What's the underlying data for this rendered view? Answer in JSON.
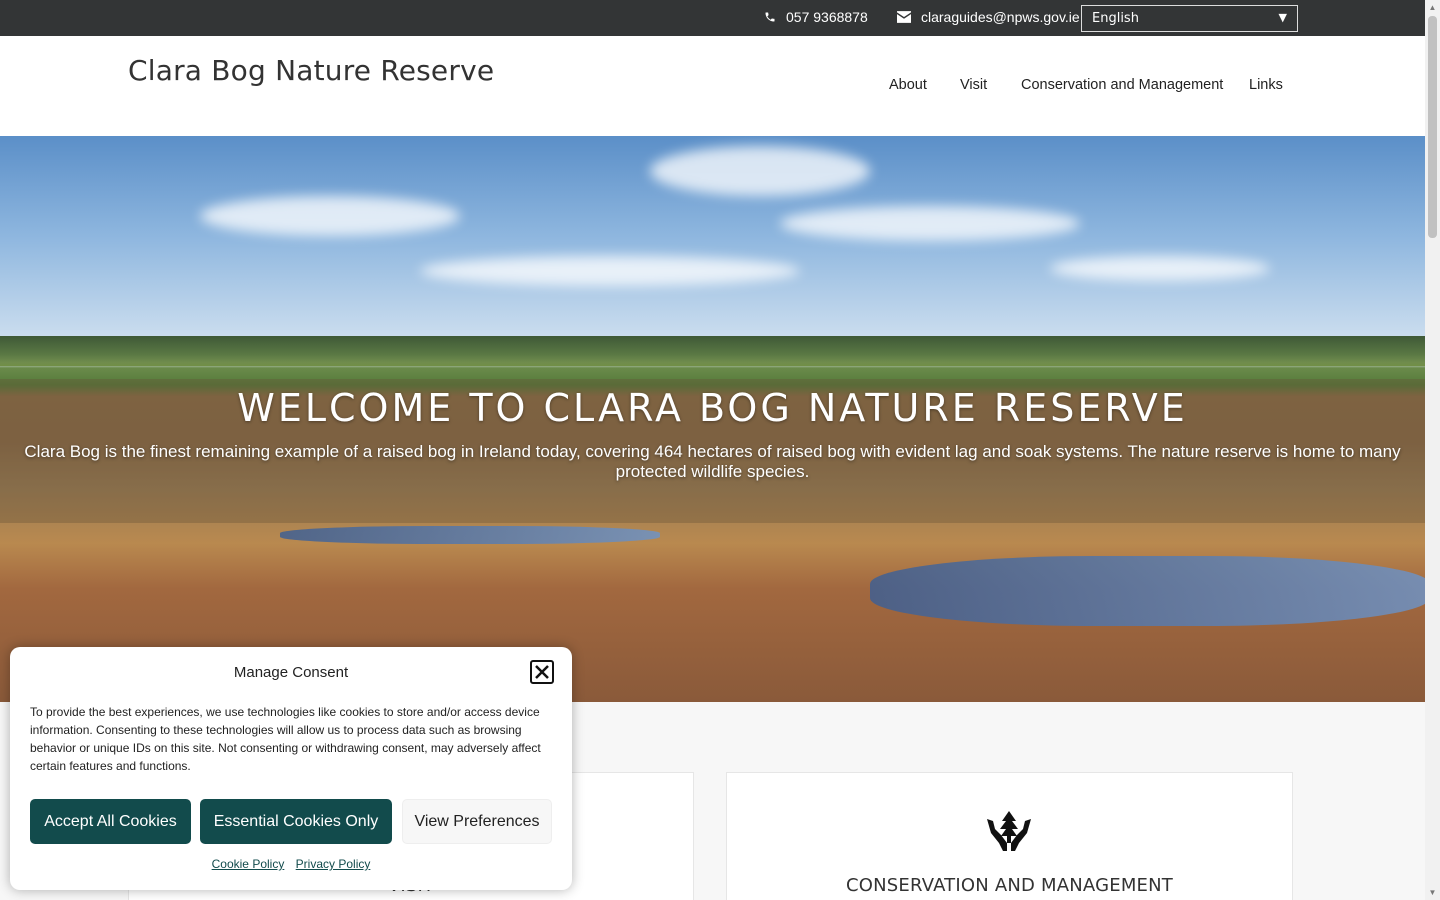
{
  "topbar": {
    "phone": "057 9368878",
    "email": "claraguides@npws.gov.ie",
    "language": "English",
    "icons": [
      "phone-icon",
      "envelope-icon"
    ]
  },
  "header": {
    "title": "Clara Bog Nature Reserve",
    "nav": [
      "About",
      "Visit",
      "Conservation and Management",
      "Links"
    ]
  },
  "hero": {
    "title": "WELCOME TO CLARA BOG NATURE RESERVE",
    "subtitle": "Clara Bog is the finest remaining example of a raised bog in Ireland today, covering 464 hectares of raised bog with evident lag and soak systems. The nature reserve is home to many protected wildlife species."
  },
  "cards": [
    {
      "title": "VISIT",
      "icon": "visit-icon"
    },
    {
      "title": "CONSERVATION AND MANAGEMENT",
      "icon": "hands-tree-icon"
    }
  ],
  "consent": {
    "title": "Manage Consent",
    "text": "To provide the best experiences, we use technologies like cookies to store and/or access device information. Consenting to these technologies will allow us to process data such as browsing behavior or unique IDs on this site. Not consenting or withdrawing consent, may adversely affect certain features and functions.",
    "accept_label": "Accept All Cookies",
    "essential_label": "Essential Cookies Only",
    "prefs_label": "View Preferences",
    "cookie_policy": "Cookie Policy",
    "privacy_policy": "Privacy Policy"
  },
  "colors": {
    "topbar": "#333536",
    "consent_button": "#124b4c"
  }
}
